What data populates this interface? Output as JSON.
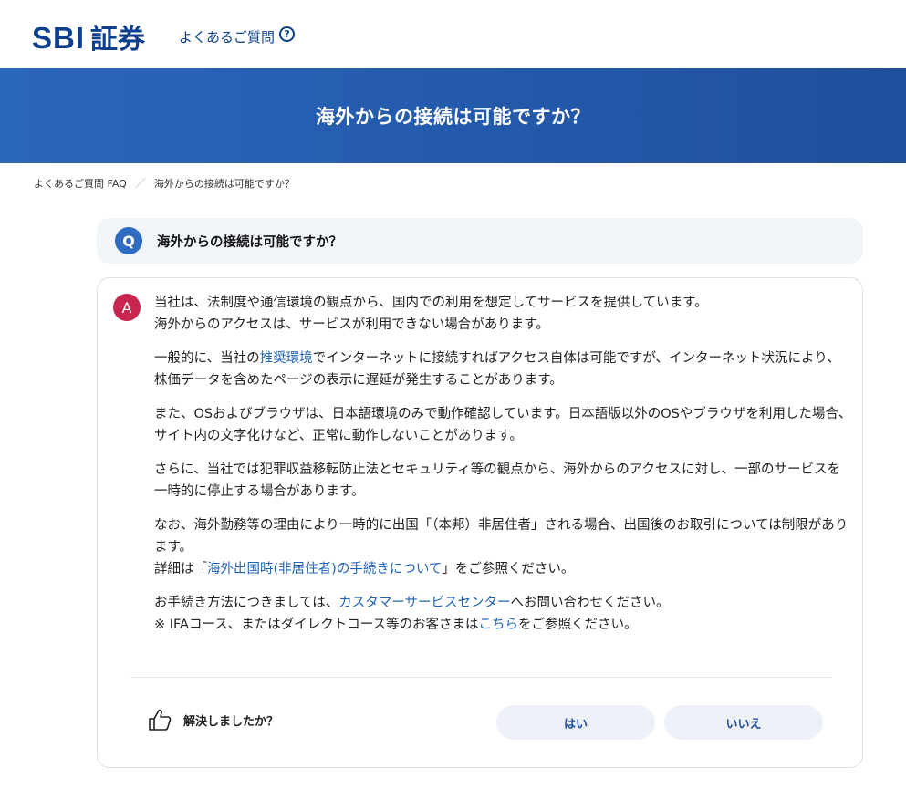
{
  "header": {
    "logo_latin": "SBI",
    "logo_kanji": "証券",
    "faq_link": "よくあるご質問",
    "faq_icon": "question-circle-icon"
  },
  "banner": {
    "title": "海外からの接続は可能ですか？"
  },
  "breadcrumb": {
    "home": "よくあるご質問 FAQ",
    "separator": "／",
    "current": "海外からの接続は可能ですか？"
  },
  "question": {
    "badge": "Q",
    "text": "海外からの接続は可能ですか？"
  },
  "answer": {
    "badge": "A",
    "p1_line1": "当社は、法制度や通信環境の観点から、国内での利用を想定してサービスを提供しています。",
    "p1_line2": "海外からのアクセスは、サービスが利用できない場合があります。",
    "p2_before": "一般的に、当社の",
    "p2_link": "推奨環境",
    "p2_after": "でインターネットに接続すればアクセス自体は可能ですが、インターネット状況により、株価データを含めたページの表示に遅延が発生することがあります。",
    "p3": "また、OSおよびブラウザは、日本語環境のみで動作確認しています。日本語版以外のOSやブラウザを利用した場合、サイト内の文字化けなど、正常に動作しないことがあります。",
    "p4": "さらに、当社では犯罪収益移転防止法とセキュリティ等の観点から、海外からのアクセスに対し、一部のサービスを一時的に停止する場合があります。",
    "p5_line1": "なお、海外勤務等の理由により一時的に出国「（本邦）非居住者」される場合、出国後のお取引については制限があります。",
    "p5_line2_before": "詳細は「",
    "p5_line2_link": "海外出国時(非居住者)の手続きについて",
    "p5_line2_after": "」をご参照ください。",
    "p6_line1_before": "お手続き方法につきましては、",
    "p6_line1_link": "カスタマーサービスセンター",
    "p6_line1_after": "へお問い合わせください。",
    "p6_line2_before": "※ IFAコース、またはダイレクトコース等のお客さまは",
    "p6_line2_link": "こちら",
    "p6_line2_after": "をご参照ください。"
  },
  "feedback": {
    "icon": "thumbs-up-icon",
    "label": "解決しましたか？",
    "yes": "はい",
    "no": "いいえ"
  }
}
